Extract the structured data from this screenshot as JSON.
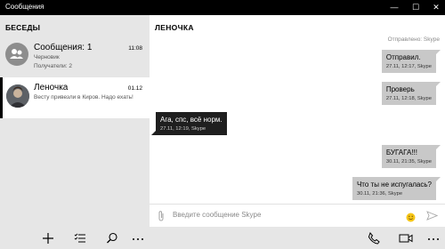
{
  "window": {
    "title": "Сообщения",
    "minimize": "—",
    "maximize": "☐",
    "close": "✕"
  },
  "sidebar": {
    "header": "БЕСЕДЫ",
    "conversations": [
      {
        "name": "Сообщения: 1",
        "time": "11:08",
        "line2": "Черновик",
        "line3": "Получатели: 2"
      },
      {
        "name": "Леночка",
        "time": "01.12",
        "line2": "Весту привезли в Киров. Надо ехать!",
        "selected": true
      }
    ]
  },
  "chat": {
    "title": "ЛЕНОЧКА",
    "sent_via": "Отправлено: Skype",
    "messages": [
      {
        "direction": "out",
        "text": "Отправил.",
        "meta": "27.11, 12:17, Skype"
      },
      {
        "direction": "out",
        "text": "Проверь",
        "meta": "27.11, 12:18, Skype"
      },
      {
        "direction": "in",
        "text": "Ага, спс, всё норм.",
        "meta": "27.11, 12:19, Skype"
      },
      {
        "direction": "out",
        "text": "БУГАГА!!!",
        "meta": "30.11, 21:35, Skype"
      },
      {
        "direction": "out",
        "text": "Что ты не испугалась?",
        "meta": "30.11, 21:36, Skype"
      }
    ],
    "composer_placeholder": "Введите сообщение Skype"
  },
  "colors": {
    "titlebar": "#000000",
    "sidebar_bg": "#e6e6e6",
    "outgoing_bubble": "#c8c8c8",
    "incoming_bubble": "#1f1f1f"
  },
  "icons": {
    "sidebar_bottom": [
      "plus-icon",
      "select-list-icon",
      "search-icon",
      "more-icon"
    ],
    "chat_bottom": [
      "phone-icon",
      "video-icon",
      "more-icon"
    ],
    "composer": [
      "attach-icon",
      "emoji-icon",
      "send-icon"
    ]
  }
}
